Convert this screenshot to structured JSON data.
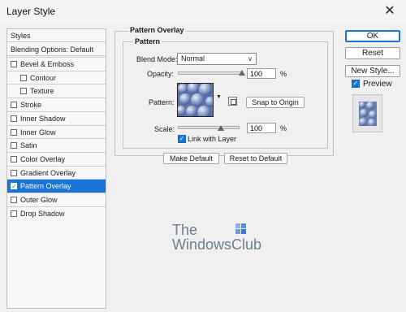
{
  "window": {
    "title": "Layer Style",
    "close_glyph": "✕"
  },
  "styles_list": {
    "header": "Styles",
    "blending_options": "Blending Options: Default",
    "items": [
      {
        "label": "Bevel & Emboss",
        "checked": false,
        "sub": false
      },
      {
        "label": "Contour",
        "checked": false,
        "sub": true
      },
      {
        "label": "Texture",
        "checked": false,
        "sub": true
      },
      {
        "label": "Stroke",
        "checked": false,
        "sub": false
      },
      {
        "label": "Inner Shadow",
        "checked": false,
        "sub": false
      },
      {
        "label": "Inner Glow",
        "checked": false,
        "sub": false
      },
      {
        "label": "Satin",
        "checked": false,
        "sub": false
      },
      {
        "label": "Color Overlay",
        "checked": false,
        "sub": false
      },
      {
        "label": "Gradient Overlay",
        "checked": false,
        "sub": false
      },
      {
        "label": "Pattern Overlay",
        "checked": true,
        "sub": false
      },
      {
        "label": "Outer Glow",
        "checked": false,
        "sub": false
      },
      {
        "label": "Drop Shadow",
        "checked": false,
        "sub": false
      }
    ]
  },
  "panel": {
    "section_title": "Pattern Overlay",
    "group_title": "Pattern",
    "blend_mode_label": "Blend Mode:",
    "blend_mode_value": "Normal",
    "opacity_label": "Opacity:",
    "opacity_value": "100",
    "opacity_unit": "%",
    "opacity_level": 1.0,
    "pattern_label": "Pattern:",
    "snap_button": "Snap to Origin",
    "scale_label": "Scale:",
    "scale_value": "100",
    "scale_unit": "%",
    "scale_level": 0.2,
    "link_with_layer": "Link with Layer",
    "link_checked": true,
    "make_default": "Make Default",
    "reset_default": "Reset to Default"
  },
  "actions": {
    "ok": "OK",
    "reset": "Reset",
    "new_style": "New Style...",
    "preview_label": "Preview",
    "preview_checked": true
  },
  "watermark": {
    "line1": "The",
    "line2": "WindowsClub"
  },
  "colors": {
    "selection": "#1a73d6",
    "pattern_base": "#6d85b6",
    "watermark": "#6c7d8f"
  }
}
